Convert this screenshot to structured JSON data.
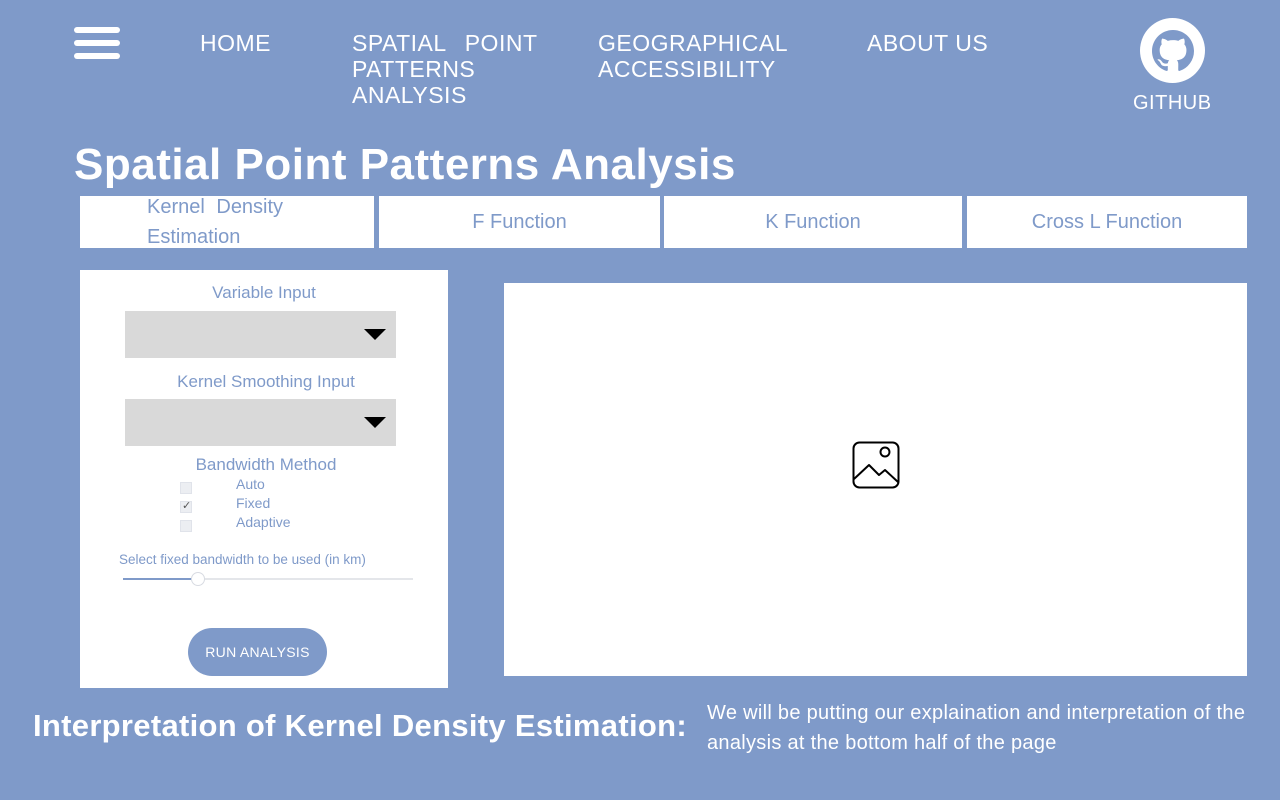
{
  "nav": {
    "home": "HOME",
    "spatial": "SPATIAL POINT PATTERNS ANALYSIS",
    "geo": "GEOGRAPHICAL ACCESSIBILITY",
    "about": "ABOUT US",
    "github": "GITHUB"
  },
  "page_title": "Spatial Point Patterns Analysis",
  "tabs": [
    {
      "label": "Kernel Density Estimation"
    },
    {
      "label": "F Function"
    },
    {
      "label": "K Function"
    },
    {
      "label": "Cross L Function"
    }
  ],
  "panel": {
    "variable_input_label": "Variable Input",
    "variable_input_value": "",
    "kernel_smoothing_label": "Kernel Smoothing Input",
    "kernel_smoothing_value": "",
    "bandwidth_method_label": "Bandwidth Method",
    "bandwidth_options": [
      {
        "label": "Auto",
        "checked": false
      },
      {
        "label": "Fixed",
        "checked": true
      },
      {
        "label": "Adaptive",
        "checked": false
      }
    ],
    "slider_label": "Select fixed bandwidth to be used (in km)",
    "slider_fraction": 0.26,
    "run_button": "RUN ANALYSIS"
  },
  "output": {
    "icon": "image-placeholder-icon"
  },
  "interpretation": {
    "title": "Interpretation of Kernel Density Estimation:",
    "text": "We will be putting our explaination and interpretation of the analysis at the bottom half of the page"
  },
  "colors": {
    "background": "#7f9ac9",
    "panel": "#ffffff",
    "dropdown": "#d9d9d9",
    "accent": "#7f9ac9"
  }
}
